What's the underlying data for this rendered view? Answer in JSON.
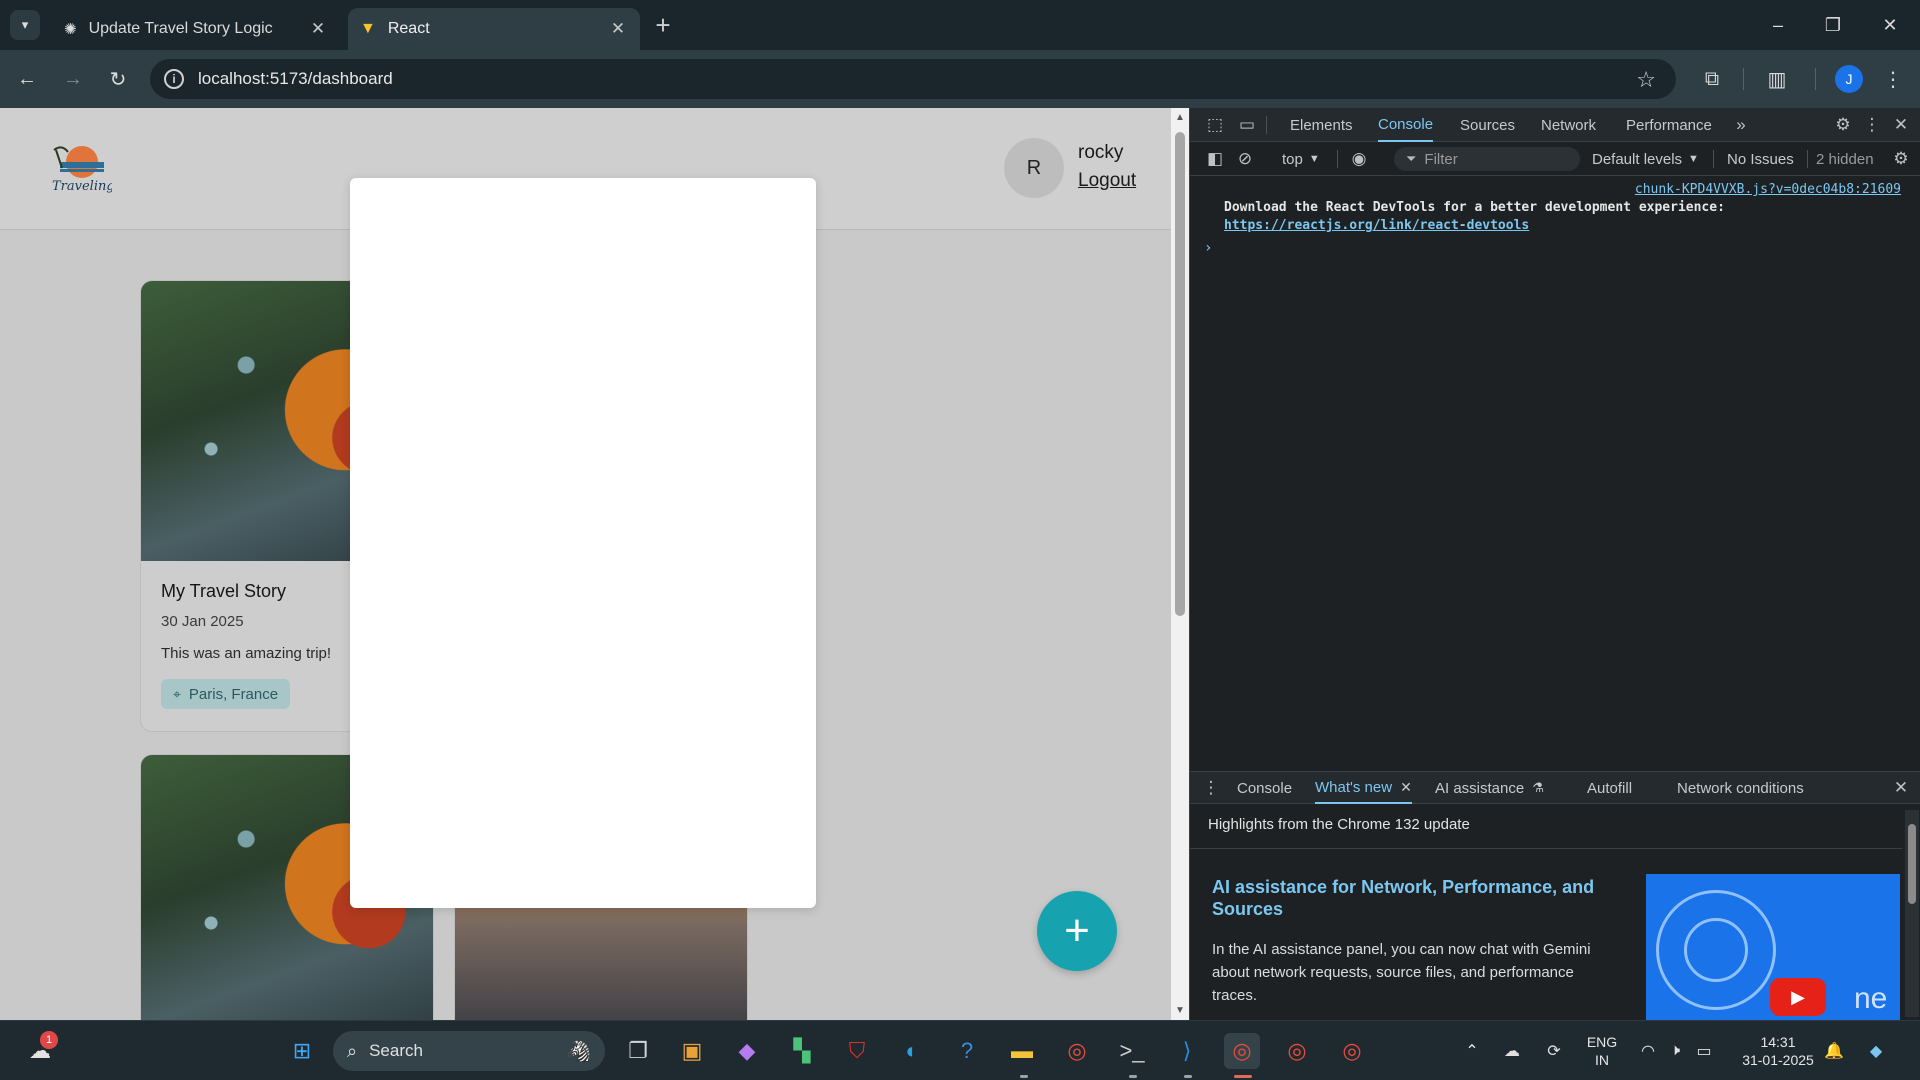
{
  "browser": {
    "tabs": [
      {
        "title": "Update Travel Story Logic",
        "icon": "chatgpt-icon"
      },
      {
        "title": "React",
        "icon": "vite-icon",
        "active": true
      }
    ],
    "url": "localhost:5173/dashboard",
    "profile_initial": "J"
  },
  "page": {
    "logo_text": "Traveling",
    "user": {
      "initial": "R",
      "name": "rocky",
      "logout_label": "Logout"
    },
    "stories": [
      {
        "title": "My Travel Story",
        "date": "30 Jan 2025",
        "description": "This was an amazing trip!",
        "location": "Paris, France"
      },
      {
        "title": "",
        "date": "",
        "description": "",
        "location": ""
      },
      {
        "title": "",
        "date": "",
        "description": "",
        "location": ""
      }
    ],
    "fab_label": "+"
  },
  "devtools": {
    "tabs": [
      "Elements",
      "Console",
      "Sources",
      "Network",
      "Performance"
    ],
    "active_tab": "Console",
    "context": "top",
    "filter_placeholder": "Filter",
    "levels": "Default levels",
    "issues": "No Issues",
    "hidden": "2 hidden",
    "console": {
      "source": "chunk-KPD4VVXB.js?v=0dec04b8:21609",
      "message": "Download the React DevTools for a better development experience:",
      "link": "https://reactjs.org/link/react-devtools",
      "prompt": "›"
    },
    "drawer": {
      "tabs": [
        "Console",
        "What's new",
        "AI assistance",
        "Autofill",
        "Network conditions"
      ],
      "active_tab": "What's new",
      "heading": "Highlights from the Chrome 132 update",
      "feature_title": "AI assistance for Network, Performance, and Sources",
      "feature_text": "In the AI assistance panel, you can now chat with Gemini about network requests, source files, and performance traces.",
      "thumb_text": "ne"
    }
  },
  "taskbar": {
    "search_label": "Search",
    "weather_badge": "1",
    "lang": "ENG",
    "region": "IN",
    "time": "14:31",
    "date": "31-01-2025"
  },
  "colors": {
    "accent": "#17a2b0",
    "devtools_accent": "#7cc7f0",
    "tag_bg": "#a8c6c8"
  }
}
